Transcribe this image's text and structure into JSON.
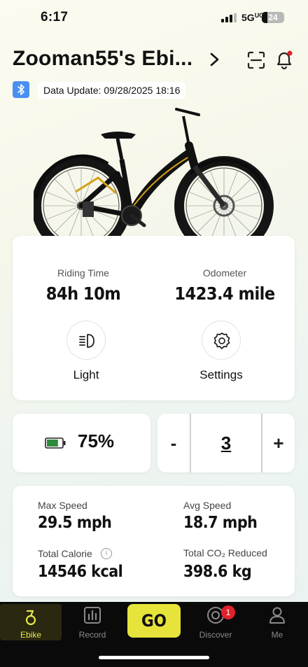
{
  "status_bar": {
    "time": "6:17",
    "network": "5G",
    "battery_level": "24"
  },
  "header": {
    "title": "Zooman55's Ebi...",
    "data_update_label": "Data Update: 09/28/2025 18:16"
  },
  "overview": {
    "riding_time_label": "Riding Time",
    "riding_time_value": "84h  10m",
    "odometer_label": "Odometer",
    "odometer_value": "1423.4 mile",
    "light_label": "Light",
    "settings_label": "Settings"
  },
  "battery": {
    "percent": "75%",
    "fill_fraction": 0.75,
    "color": "#2e8b3e"
  },
  "assist": {
    "minus_label": "-",
    "level": "3",
    "plus_label": "+"
  },
  "stats": {
    "max_speed_label": "Max Speed",
    "max_speed_value": "29.5 mph",
    "avg_speed_label": "Avg Speed",
    "avg_speed_value": "18.7 mph",
    "calorie_label": "Total Calorie",
    "calorie_value": "14546 kcal",
    "co2_label": "Total CO₂ Reduced",
    "co2_value": "398.6 kg"
  },
  "nav": {
    "items": [
      {
        "label": "Ebike",
        "icon": "ebike-icon"
      },
      {
        "label": "Record",
        "icon": "chart-icon"
      },
      {
        "label": "GO",
        "icon": "go-button"
      },
      {
        "label": "Discover",
        "icon": "discover-icon"
      },
      {
        "label": "Me",
        "icon": "person-icon"
      }
    ],
    "discover_badge": "1"
  },
  "colors": {
    "accent": "#e6e43a",
    "bluetooth": "#4a8ff0",
    "badge": "#e0222a"
  }
}
